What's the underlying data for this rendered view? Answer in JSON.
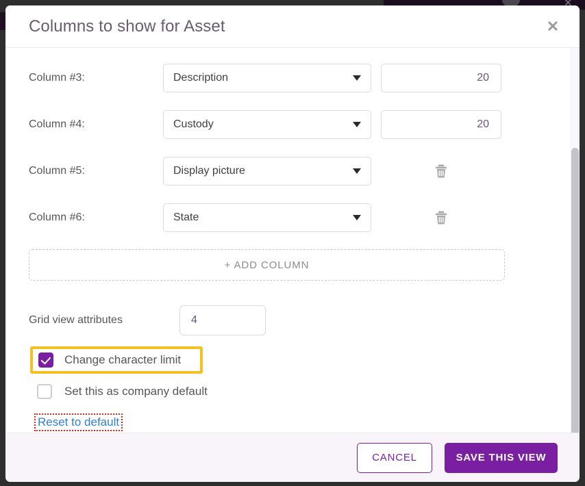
{
  "modal": {
    "title": "Columns to show for Asset",
    "close_icon": "close-icon"
  },
  "columns": [
    {
      "label": "Column #3:",
      "value": "Description",
      "limit": "20",
      "has_trash": false
    },
    {
      "label": "Column #4:",
      "value": "Custody",
      "limit": "20",
      "has_trash": false
    },
    {
      "label": "Column #5:",
      "value": "Display picture",
      "limit": "",
      "has_trash": true
    },
    {
      "label": "Column #6:",
      "value": "State",
      "limit": "",
      "has_trash": true
    }
  ],
  "add_column": {
    "label": "+ ADD COLUMN"
  },
  "grid_view": {
    "label": "Grid view attributes",
    "value": "4"
  },
  "checkboxes": [
    {
      "label": "Change character limit",
      "checked": true,
      "highlighted": true
    },
    {
      "label": "Set this as company default",
      "checked": false,
      "highlighted": false
    }
  ],
  "reset": {
    "label": "Reset to default",
    "highlighted": true
  },
  "footer": {
    "cancel_label": "CANCEL",
    "save_label": "SAVE THIS VIEW"
  },
  "colors": {
    "brand_purple": "#7a1fa2",
    "title_purple": "#6a5b71",
    "value_purple": "#6d4f86",
    "highlight_yellow": "#f5c024",
    "highlight_red": "#e01f1f",
    "link_blue": "#2f7fd0",
    "footer_bg": "#f9f4f9",
    "backdrop": "#2e2e2e"
  }
}
